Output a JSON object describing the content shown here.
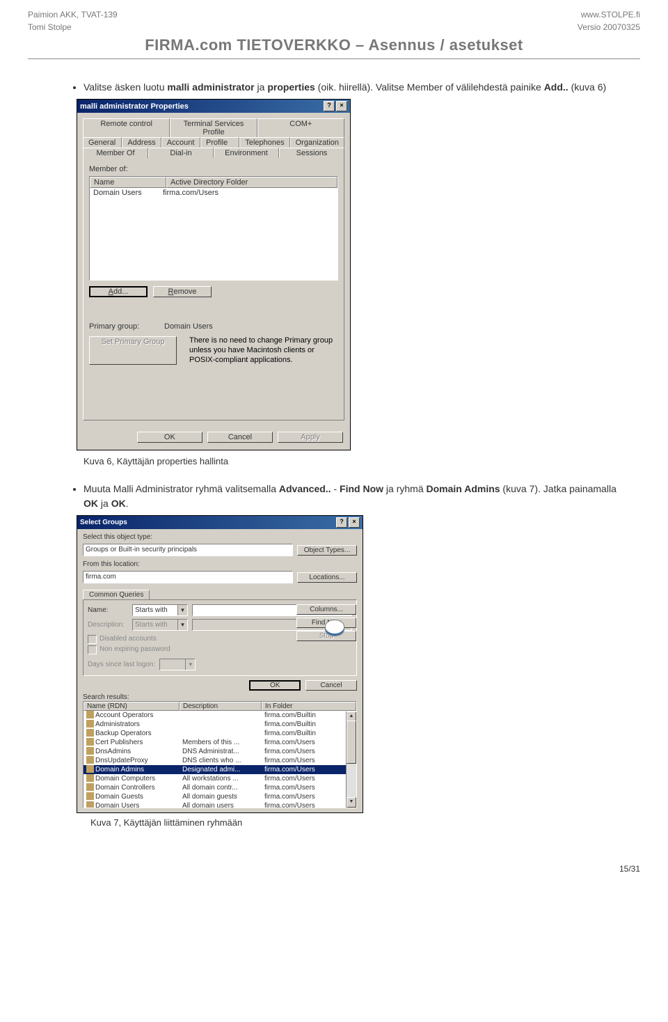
{
  "header": {
    "left_top": "Paimion AKK, TVAT-139",
    "left_bottom": "Tomi Stolpe",
    "right_top": "www.STOLPE.fi",
    "right_bottom": "Versio 20070325",
    "title": "FIRMA.com TIETOVERKKO – Asennus / asetukset"
  },
  "footer": {
    "page": "15/31"
  },
  "bullets": [
    {
      "pre": "Valitse äsken luotu ",
      "b1": "malli administrator",
      "mid": " ja ",
      "b2": "properties",
      "post1": " (oik. hiirellä). Valitse Member of välilehdestä painike ",
      "b3": "Add..",
      "post2": " (kuva 6)"
    },
    {
      "pre": "Muuta Malli Administrator ryhmä valitsemalla ",
      "b1": "Advanced..",
      "mid": " - ",
      "b2": "Find Now",
      "post1": " ja ryhmä ",
      "b3": "Domain Admins",
      "post2": " (kuva 7). Jatka painamalla ",
      "b4": "OK",
      "post3": " ja ",
      "b5": "OK",
      "post4": "."
    }
  ],
  "caption6": "Kuva 6, Käyttäjän properties hallinta",
  "caption7": "Kuva 7, Käyttäjän liittäminen ryhmään",
  "dlg1": {
    "title": "malli administrator Properties",
    "help": "?",
    "close": "×",
    "tabs_row1": [
      "Remote control",
      "Terminal Services Profile",
      "COM+"
    ],
    "tabs_row2": [
      "General",
      "Address",
      "Account",
      "Profile",
      "Telephones",
      "Organization"
    ],
    "tabs_row3": [
      "Member Of",
      "Dial-in",
      "Environment",
      "Sessions"
    ],
    "memberof_label": "Member of:",
    "list_headers": {
      "name": "Name",
      "folder": "Active Directory Folder"
    },
    "list_row": {
      "name": "Domain Users",
      "folder": "firma.com/Users"
    },
    "btn_add": "Add...",
    "btn_remove": "Remove",
    "primary_label": "Primary group:",
    "primary_value": "Domain Users",
    "btn_setprimary": "Set Primary Group",
    "primary_note": "There is no need to change Primary group unless you have Macintosh clients or POSIX-compliant applications.",
    "btn_ok": "OK",
    "btn_cancel": "Cancel",
    "btn_apply": "Apply"
  },
  "dlg2": {
    "title": "Select Groups",
    "help": "?",
    "close": "×",
    "lbl_objtype": "Select this object type:",
    "val_objtype": "Groups or Built-in security principals",
    "btn_objtypes": "Object Types...",
    "lbl_location": "From this location:",
    "val_location": "firma.com",
    "btn_locations": "Locations...",
    "tab_cq": "Common Queries",
    "lbl_name": "Name:",
    "combo_starts": "Starts with",
    "lbl_desc": "Description:",
    "combo_starts2": "Starts with",
    "chk_disabled": "Disabled accounts",
    "chk_nonexp": "Non expiring password",
    "lbl_days": "Days since last logon:",
    "btn_columns": "Columns...",
    "btn_findnow": "Find Now",
    "btn_stop": "Stop",
    "btn_ok": "OK",
    "btn_cancel": "Cancel",
    "lbl_search": "Search results:",
    "res_headers": {
      "name": "Name (RDN)",
      "desc": "Description",
      "folder": "In Folder"
    },
    "results": [
      {
        "name": "Account Operators",
        "desc": "",
        "folder": "firma.com/Builtin",
        "sel": false
      },
      {
        "name": "Administrators",
        "desc": "",
        "folder": "firma.com/Builtin",
        "sel": false
      },
      {
        "name": "Backup Operators",
        "desc": "",
        "folder": "firma.com/Builtin",
        "sel": false
      },
      {
        "name": "Cert Publishers",
        "desc": "Members of this ...",
        "folder": "firma.com/Users",
        "sel": false
      },
      {
        "name": "DnsAdmins",
        "desc": "DNS Administrat...",
        "folder": "firma.com/Users",
        "sel": false
      },
      {
        "name": "DnsUpdateProxy",
        "desc": "DNS clients who ...",
        "folder": "firma.com/Users",
        "sel": false
      },
      {
        "name": "Domain Admins",
        "desc": "Designated admi...",
        "folder": "firma.com/Users",
        "sel": true
      },
      {
        "name": "Domain Computers",
        "desc": "All workstations ...",
        "folder": "firma.com/Users",
        "sel": false
      },
      {
        "name": "Domain Controllers",
        "desc": "All domain contr...",
        "folder": "firma.com/Users",
        "sel": false
      },
      {
        "name": "Domain Guests",
        "desc": "All domain guests",
        "folder": "firma.com/Users",
        "sel": false
      },
      {
        "name": "Domain Users",
        "desc": "All domain users",
        "folder": "firma.com/Users",
        "sel": false
      }
    ]
  }
}
